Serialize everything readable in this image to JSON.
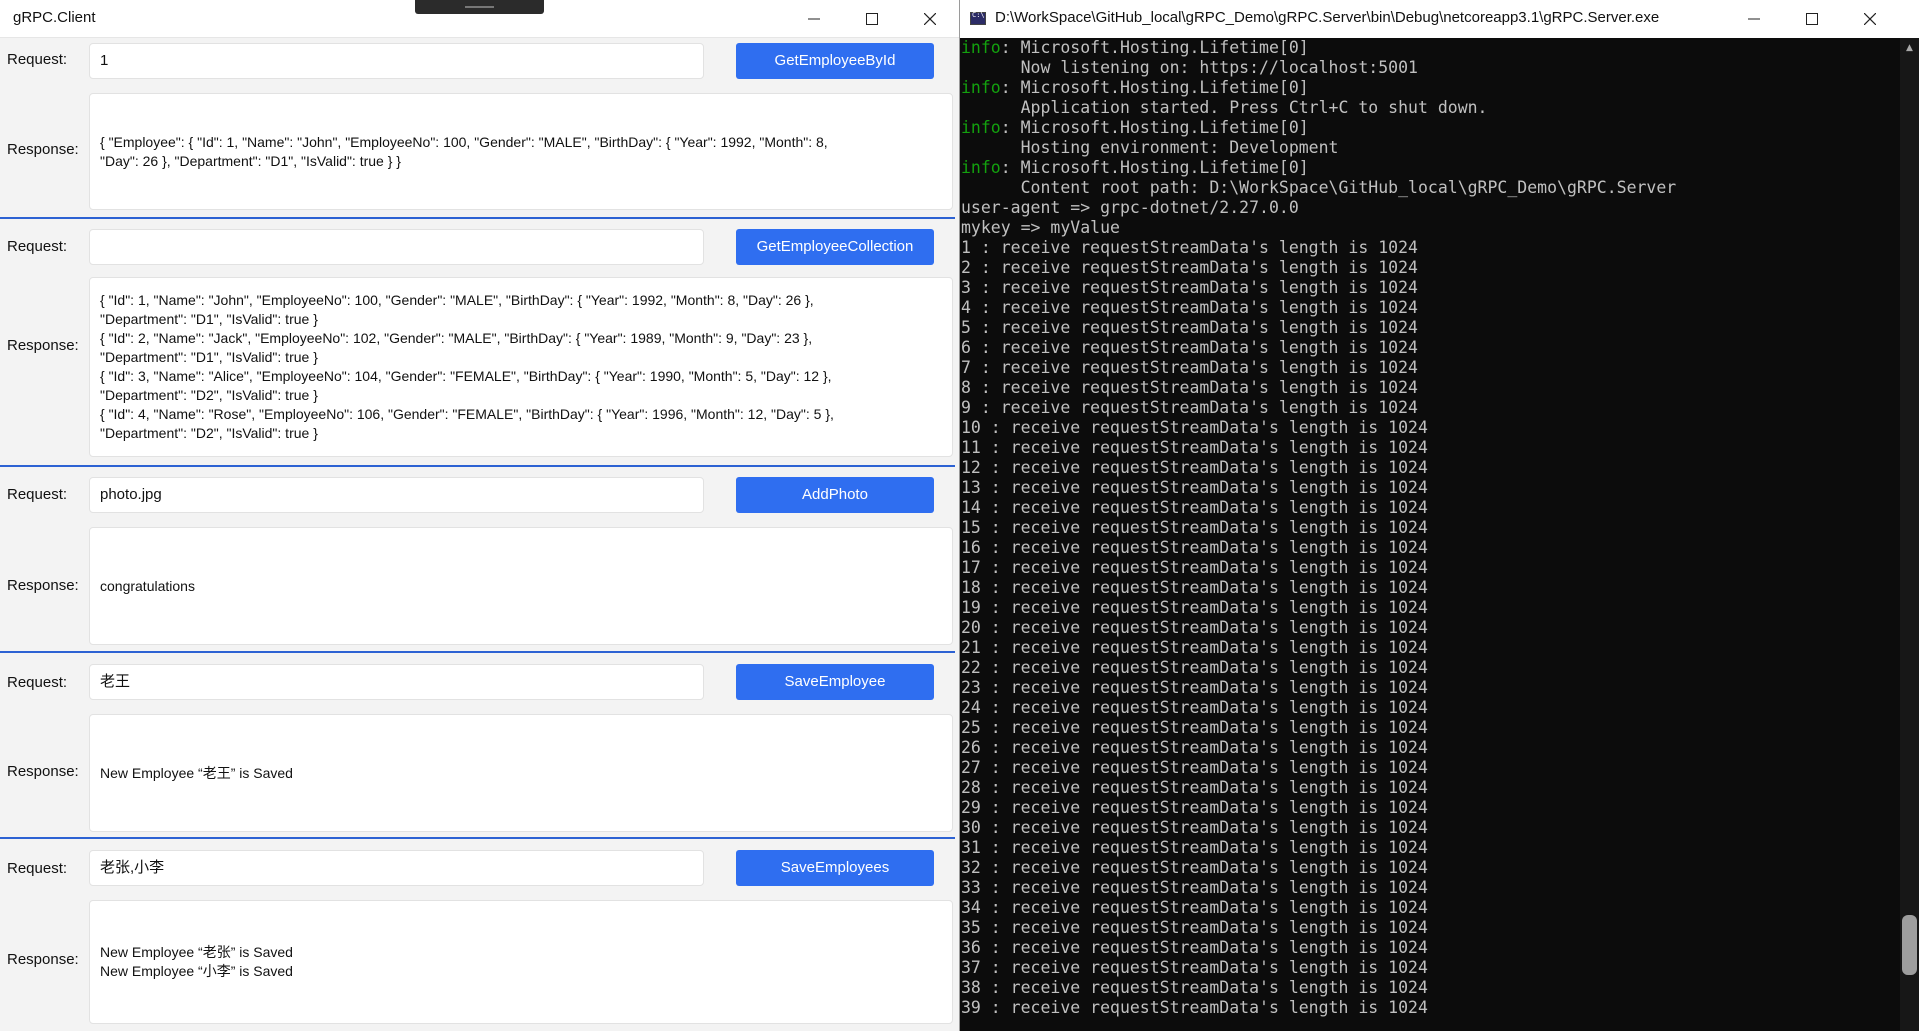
{
  "client": {
    "title": "gRPC.Client",
    "sections": [
      {
        "request_label": "Request:",
        "request_value": "1",
        "button_label": "GetEmployeeById",
        "response_label": "Response:",
        "response_text": "{ \"Employee\": { \"Id\": 1, \"Name\": \"John\", \"EmployeeNo\": 100, \"Gender\": \"MALE\", \"BirthDay\": { \"Year\": 1992, \"Month\": 8,\n\"Day\": 26 }, \"Department\": \"D1\", \"IsValid\": true } }"
      },
      {
        "request_label": "Request:",
        "request_value": "",
        "button_label": "GetEmployeeCollection",
        "response_label": "Response:",
        "response_text": "{ \"Id\": 1, \"Name\": \"John\", \"EmployeeNo\": 100, \"Gender\": \"MALE\", \"BirthDay\": { \"Year\": 1992, \"Month\": 8, \"Day\": 26 },\n\"Department\": \"D1\", \"IsValid\": true }\n{ \"Id\": 2, \"Name\": \"Jack\", \"EmployeeNo\": 102, \"Gender\": \"MALE\", \"BirthDay\": { \"Year\": 1989, \"Month\": 9, \"Day\": 23 },\n\"Department\": \"D1\", \"IsValid\": true }\n{ \"Id\": 3, \"Name\": \"Alice\", \"EmployeeNo\": 104, \"Gender\": \"FEMALE\", \"BirthDay\": { \"Year\": 1990, \"Month\": 5, \"Day\": 12 },\n\"Department\": \"D2\", \"IsValid\": true }\n{ \"Id\": 4, \"Name\": \"Rose\", \"EmployeeNo\": 106, \"Gender\": \"FEMALE\", \"BirthDay\": { \"Year\": 1996, \"Month\": 12, \"Day\": 5 },\n\"Department\": \"D2\", \"IsValid\": true }"
      },
      {
        "request_label": "Request:",
        "request_value": "photo.jpg",
        "button_label": "AddPhoto",
        "response_label": "Response:",
        "response_text": "congratulations"
      },
      {
        "request_label": "Request:",
        "request_value": "老王",
        "button_label": "SaveEmployee",
        "response_label": "Response:",
        "response_text": "New Employee “老王” is Saved"
      },
      {
        "request_label": "Request:",
        "request_value": "老张,小李",
        "button_label": "SaveEmployees",
        "response_label": "Response:",
        "response_text": "New Employee “老张” is Saved\nNew Employee “小李” is Saved"
      }
    ]
  },
  "console": {
    "title": "D:\\WorkSpace\\GitHub_local\\gRPC_Demo\\gRPC.Server\\bin\\Debug\\netcoreapp3.1\\gRPC.Server.exe",
    "lines": [
      {
        "prefix": "info",
        "text": ": Microsoft.Hosting.Lifetime[0]"
      },
      {
        "prefix": "",
        "text": "      Now listening on: https://localhost:5001"
      },
      {
        "prefix": "info",
        "text": ": Microsoft.Hosting.Lifetime[0]"
      },
      {
        "prefix": "",
        "text": "      Application started. Press Ctrl+C to shut down."
      },
      {
        "prefix": "info",
        "text": ": Microsoft.Hosting.Lifetime[0]"
      },
      {
        "prefix": "",
        "text": "      Hosting environment: Development"
      },
      {
        "prefix": "info",
        "text": ": Microsoft.Hosting.Lifetime[0]"
      },
      {
        "prefix": "",
        "text": "      Content root path: D:\\WorkSpace\\GitHub_local\\gRPC_Demo\\gRPC.Server"
      },
      {
        "prefix": "",
        "text": "user-agent => grpc-dotnet/2.27.0.0"
      },
      {
        "prefix": "",
        "text": "mykey => myValue"
      },
      {
        "prefix": "",
        "text": "1 : receive requestStreamData's length is 1024"
      },
      {
        "prefix": "",
        "text": "2 : receive requestStreamData's length is 1024"
      },
      {
        "prefix": "",
        "text": "3 : receive requestStreamData's length is 1024"
      },
      {
        "prefix": "",
        "text": "4 : receive requestStreamData's length is 1024"
      },
      {
        "prefix": "",
        "text": "5 : receive requestStreamData's length is 1024"
      },
      {
        "prefix": "",
        "text": "6 : receive requestStreamData's length is 1024"
      },
      {
        "prefix": "",
        "text": "7 : receive requestStreamData's length is 1024"
      },
      {
        "prefix": "",
        "text": "8 : receive requestStreamData's length is 1024"
      },
      {
        "prefix": "",
        "text": "9 : receive requestStreamData's length is 1024"
      },
      {
        "prefix": "",
        "text": "10 : receive requestStreamData's length is 1024"
      },
      {
        "prefix": "",
        "text": "11 : receive requestStreamData's length is 1024"
      },
      {
        "prefix": "",
        "text": "12 : receive requestStreamData's length is 1024"
      },
      {
        "prefix": "",
        "text": "13 : receive requestStreamData's length is 1024"
      },
      {
        "prefix": "",
        "text": "14 : receive requestStreamData's length is 1024"
      },
      {
        "prefix": "",
        "text": "15 : receive requestStreamData's length is 1024"
      },
      {
        "prefix": "",
        "text": "16 : receive requestStreamData's length is 1024"
      },
      {
        "prefix": "",
        "text": "17 : receive requestStreamData's length is 1024"
      },
      {
        "prefix": "",
        "text": "18 : receive requestStreamData's length is 1024"
      },
      {
        "prefix": "",
        "text": "19 : receive requestStreamData's length is 1024"
      },
      {
        "prefix": "",
        "text": "20 : receive requestStreamData's length is 1024"
      },
      {
        "prefix": "",
        "text": "21 : receive requestStreamData's length is 1024"
      },
      {
        "prefix": "",
        "text": "22 : receive requestStreamData's length is 1024"
      },
      {
        "prefix": "",
        "text": "23 : receive requestStreamData's length is 1024"
      },
      {
        "prefix": "",
        "text": "24 : receive requestStreamData's length is 1024"
      },
      {
        "prefix": "",
        "text": "25 : receive requestStreamData's length is 1024"
      },
      {
        "prefix": "",
        "text": "26 : receive requestStreamData's length is 1024"
      },
      {
        "prefix": "",
        "text": "27 : receive requestStreamData's length is 1024"
      },
      {
        "prefix": "",
        "text": "28 : receive requestStreamData's length is 1024"
      },
      {
        "prefix": "",
        "text": "29 : receive requestStreamData's length is 1024"
      },
      {
        "prefix": "",
        "text": "30 : receive requestStreamData's length is 1024"
      },
      {
        "prefix": "",
        "text": "31 : receive requestStreamData's length is 1024"
      },
      {
        "prefix": "",
        "text": "32 : receive requestStreamData's length is 1024"
      },
      {
        "prefix": "",
        "text": "33 : receive requestStreamData's length is 1024"
      },
      {
        "prefix": "",
        "text": "34 : receive requestStreamData's length is 1024"
      },
      {
        "prefix": "",
        "text": "35 : receive requestStreamData's length is 1024"
      },
      {
        "prefix": "",
        "text": "36 : receive requestStreamData's length is 1024"
      },
      {
        "prefix": "",
        "text": "37 : receive requestStreamData's length is 1024"
      },
      {
        "prefix": "",
        "text": "38 : receive requestStreamData's length is 1024"
      },
      {
        "prefix": "",
        "text": "39 : receive requestStreamData's length is 1024"
      }
    ]
  },
  "colors": {
    "button_blue": "#2f6ef0",
    "separator_blue": "#2d62d3",
    "console_info_green": "#13a10e",
    "console_text": "#c0c0c0"
  },
  "icons": {
    "window_controls": [
      "minimize-icon",
      "maximize-icon",
      "close-icon"
    ],
    "console_app": "console-app-icon",
    "scroll": "scroll-up-arrow-icon"
  }
}
